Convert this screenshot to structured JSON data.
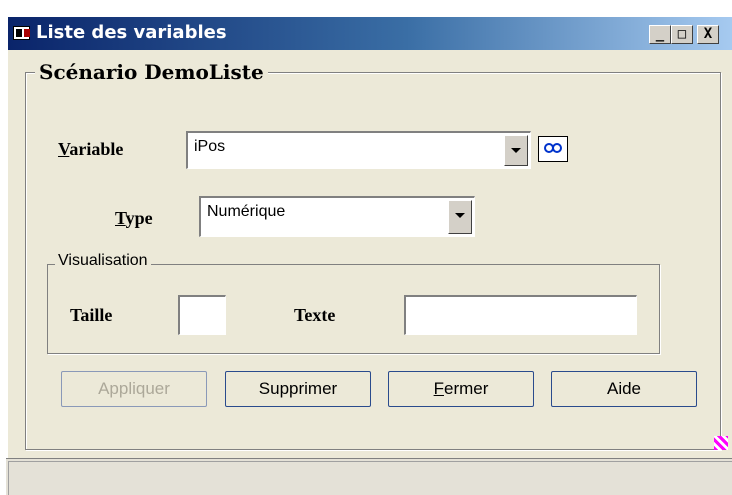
{
  "window": {
    "title": "Liste des variables",
    "title_buttons": {
      "minimize": "_",
      "maximize": "□",
      "close": "X"
    }
  },
  "scenario": {
    "legend": "Scénario DemoListe"
  },
  "variable": {
    "label_underlined": "V",
    "label_rest": "ariable",
    "value": "iPos"
  },
  "type": {
    "label_underlined": "T",
    "label_rest": "ype",
    "value": "Numérique"
  },
  "visualisation": {
    "legend": "Visualisation",
    "taille_label": "Taille",
    "taille_value": "",
    "texte_label": "Texte",
    "texte_value": ""
  },
  "buttons": {
    "appliquer": "Appliquer",
    "supprimer": "Supprimer",
    "fermer_underlined": "F",
    "fermer_rest": "ermer",
    "aide": "Aide"
  },
  "icons": {
    "app": "app-window-icon",
    "search": "binoculars-icon",
    "dropdown": "chevron-down-icon",
    "resize": "resize-grip-icon"
  },
  "colors": {
    "titlebar_start": "#0a246a",
    "titlebar_end": "#a6caf0",
    "window_bg": "#ece9d8",
    "disabled_text": "#aca899"
  }
}
